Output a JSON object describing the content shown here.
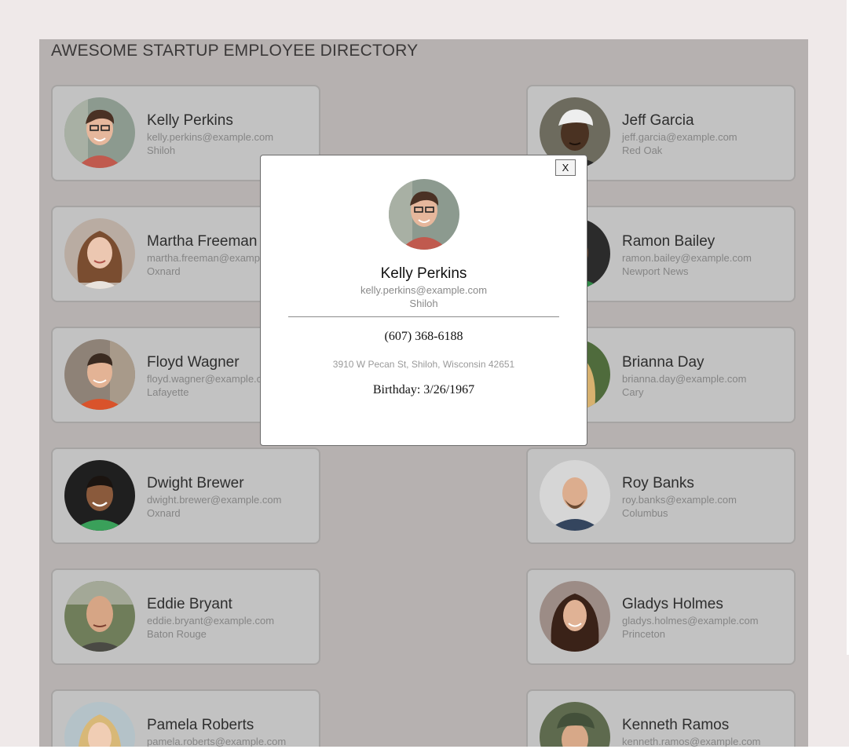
{
  "page": {
    "title": "AWESOME STARTUP EMPLOYEE DIRECTORY"
  },
  "employees": [
    {
      "name": "Kelly Perkins",
      "email": "kelly.perkins@example.com",
      "city": "Shiloh"
    },
    {
      "name": "Jeff Garcia",
      "email": "jeff.garcia@example.com",
      "city": "Red Oak"
    },
    {
      "name": "Martha Freeman",
      "email": "martha.freeman@example.com",
      "city": "Oxnard"
    },
    {
      "name": "Ramon Bailey",
      "email": "ramon.bailey@example.com",
      "city": "Newport News"
    },
    {
      "name": "Floyd Wagner",
      "email": "floyd.wagner@example.com",
      "city": "Lafayette"
    },
    {
      "name": "Brianna Day",
      "email": "brianna.day@example.com",
      "city": "Cary"
    },
    {
      "name": "Dwight Brewer",
      "email": "dwight.brewer@example.com",
      "city": "Oxnard"
    },
    {
      "name": "Roy Banks",
      "email": "roy.banks@example.com",
      "city": "Columbus"
    },
    {
      "name": "Eddie Bryant",
      "email": "eddie.bryant@example.com",
      "city": "Baton Rouge"
    },
    {
      "name": "Gladys Holmes",
      "email": "gladys.holmes@example.com",
      "city": "Princeton"
    },
    {
      "name": "Pamela Roberts",
      "email": "pamela.roberts@example.com",
      "city": ""
    },
    {
      "name": "Kenneth Ramos",
      "email": "kenneth.ramos@example.com",
      "city": ""
    }
  ],
  "modal": {
    "close_label": "X",
    "name": "Kelly Perkins",
    "email": "kelly.perkins@example.com",
    "city": "Shiloh",
    "phone": "(607) 368-6188",
    "address": "3910 W Pecan St, Shiloh, Wisconsin 42651",
    "birthday": "Birthday: 3/26/1967"
  }
}
